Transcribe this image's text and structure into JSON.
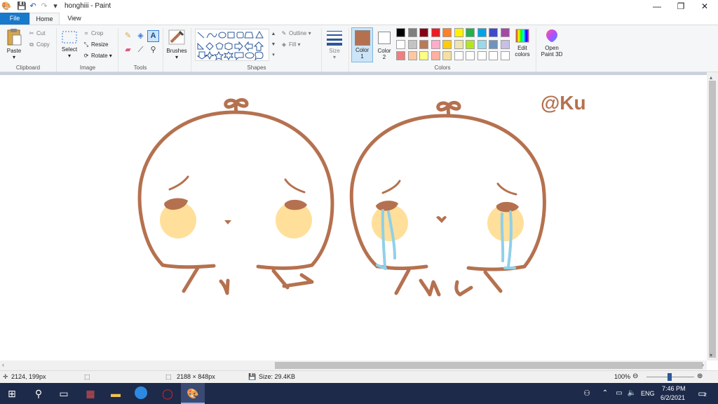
{
  "window": {
    "title": "honghiii - Paint",
    "controls": {
      "minimize": "—",
      "restore": "❐",
      "close": "✕"
    }
  },
  "tabs": {
    "file": "File",
    "home": "Home",
    "view": "View"
  },
  "ribbon": {
    "clipboard": {
      "label": "Clipboard",
      "paste": "Paste",
      "cut": "Cut",
      "copy": "Copy"
    },
    "image": {
      "label": "Image",
      "select": "Select",
      "crop": "Crop",
      "resize": "Resize",
      "rotate": "Rotate"
    },
    "tools": {
      "label": "Tools"
    },
    "brushes": {
      "label": "Brushes"
    },
    "shapes": {
      "label": "Shapes",
      "outline": "Outline",
      "fill": "Fill"
    },
    "size": {
      "label": "Size"
    },
    "colors": {
      "label": "Colors",
      "color1_label": "Color",
      "color1_num": "1",
      "color2_label": "Color",
      "color2_num": "2",
      "color1_value": "#b5714f",
      "color2_value": "#ffffff",
      "edit_label": "Edit",
      "edit_label2": "colors",
      "palette_row1": [
        "#000000",
        "#7f7f7f",
        "#880015",
        "#ed1c24",
        "#ff7f27",
        "#fff200",
        "#22b14c",
        "#00a2e8",
        "#3f48cc",
        "#a349a4"
      ],
      "palette_row2": [
        "#ffffff",
        "#c3c3c3",
        "#b97a57",
        "#ffaec9",
        "#ffc90e",
        "#efe4b0",
        "#b5e61d",
        "#99d9ea",
        "#7092be",
        "#c8bfe7"
      ],
      "palette_row3": [
        "#f08080",
        "#ffc8a0",
        "#ffff80",
        "#ffb0a0",
        "#f5e0a0",
        "#ffffff",
        "#ffffff",
        "#ffffff",
        "#ffffff",
        "#ffffff"
      ]
    },
    "paint3d": {
      "label": "Open",
      "label2": "Paint 3D"
    }
  },
  "canvas_text": "@Ku",
  "statusbar": {
    "cursor": "2124, 199px",
    "dimensions": "2188 × 848px",
    "size": "Size: 29.4KB",
    "zoom": "100%"
  },
  "taskbar": {
    "language": "ENG",
    "time": "7:46 PM",
    "date": "6/2/2021",
    "notification_count": "2"
  }
}
